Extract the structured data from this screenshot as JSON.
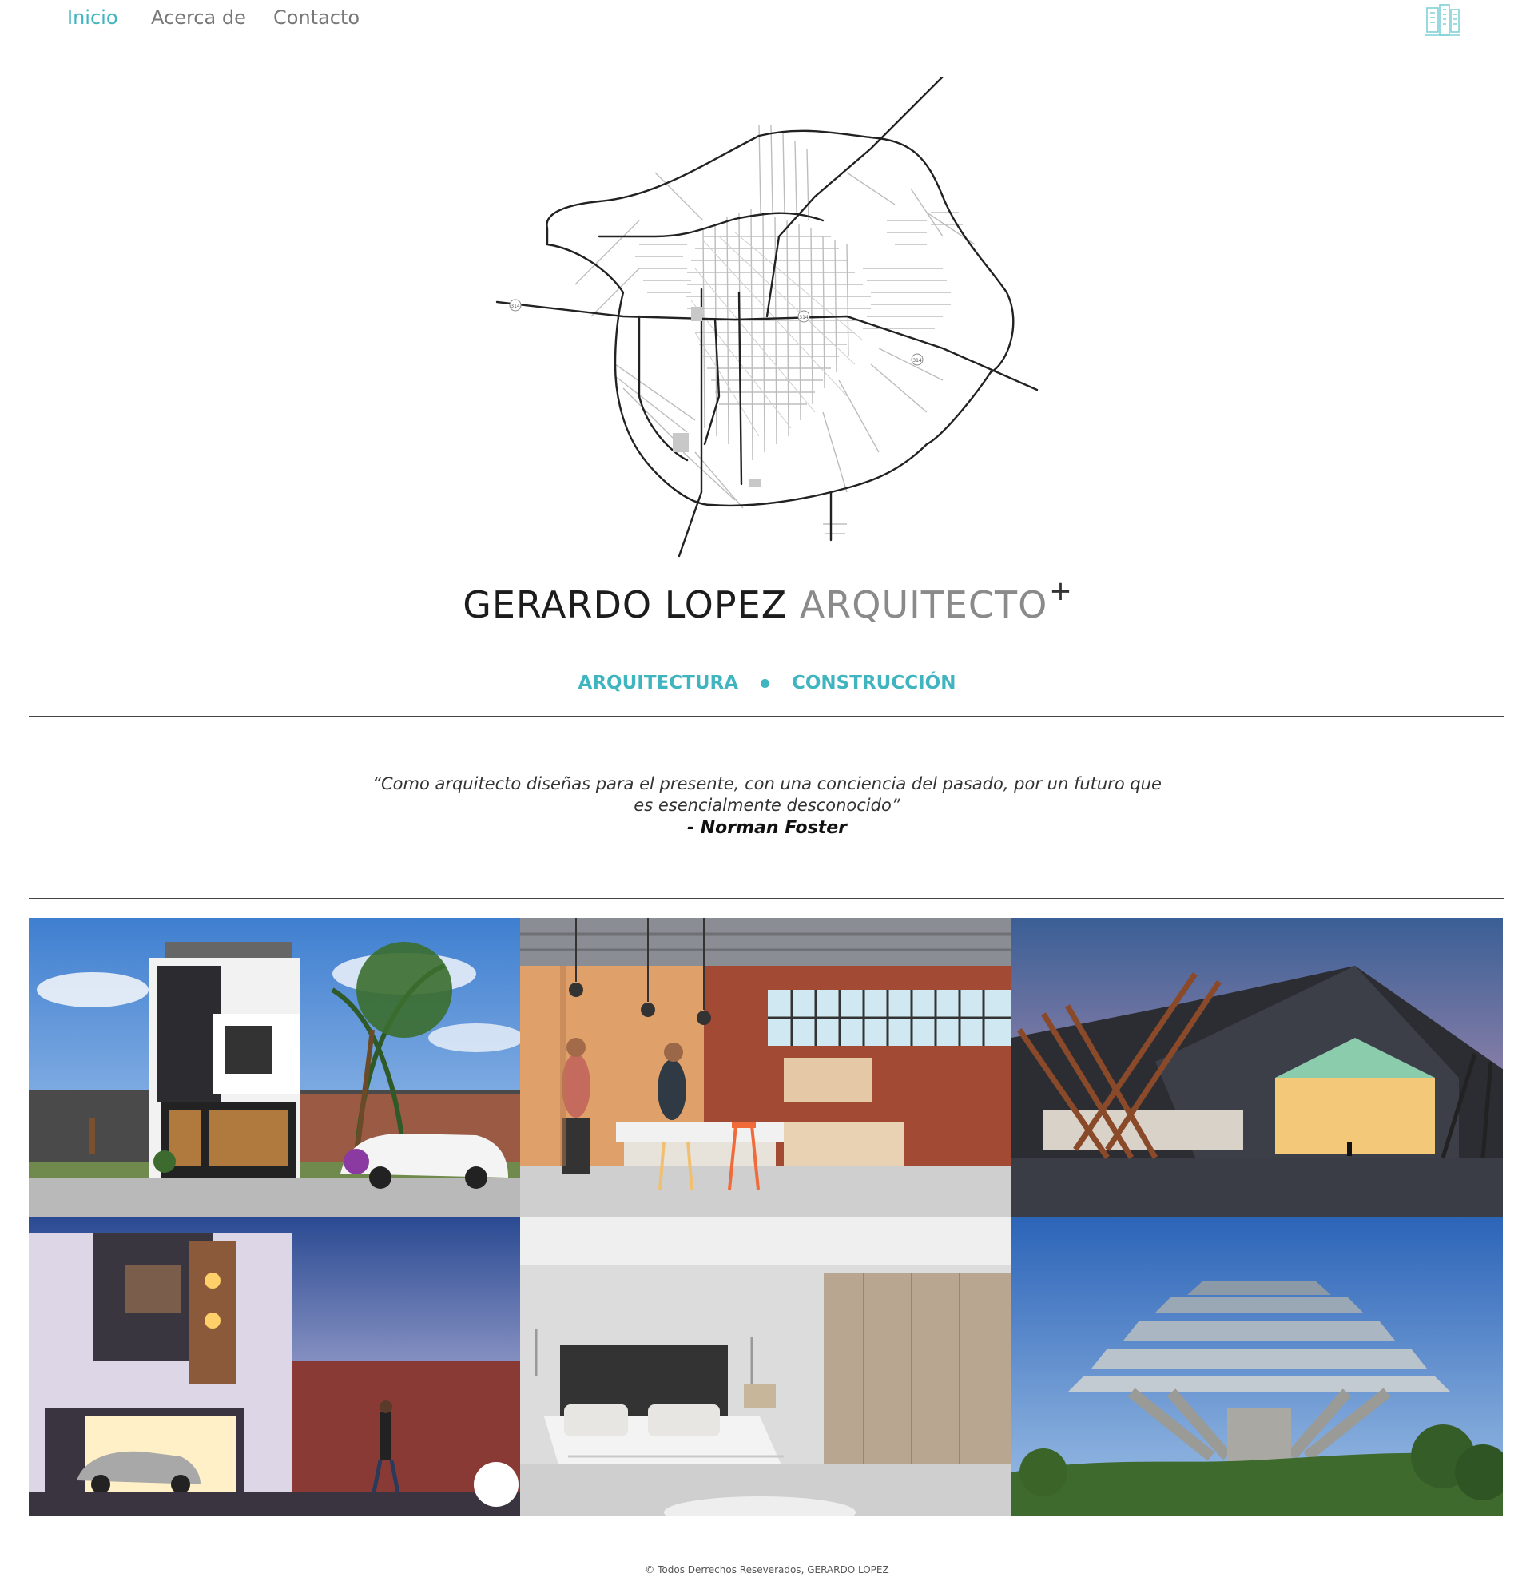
{
  "nav": {
    "items": [
      {
        "label": "Inicio",
        "active": true
      },
      {
        "label": "Acerca de",
        "active": false
      },
      {
        "label": "Contacto",
        "active": false
      }
    ],
    "logo_icon": "building-logo-icon"
  },
  "hero": {
    "map_icon": "city-map-illustration",
    "road_labels": [
      "314",
      "314",
      "314"
    ],
    "brand_name": "GERARDO LOPEZ",
    "brand_role": "ARQUITECTO",
    "brand_sup": "+",
    "services": [
      "ARQUITECTURA",
      "CONSTRUCCIÓN"
    ]
  },
  "quote": {
    "text": "“Como arquitecto diseñas para el presente, con una conciencia del pasado, por un futuro que es esencialmente desconocido”",
    "author": "- Norman Foster"
  },
  "gallery": [
    {
      "name": "house-render-modern-facade"
    },
    {
      "name": "industrial-kitchen-render"
    },
    {
      "name": "angular-pavilion-render"
    },
    {
      "name": "house-render-night-facade"
    },
    {
      "name": "bedroom-render"
    },
    {
      "name": "library-brutalist-photo"
    }
  ],
  "footer": {
    "text": "© Todos Derrechos Reseverados, GERARDO LOPEZ"
  },
  "colors": {
    "accent": "#40b4bf",
    "text_dark": "#1c1c1c",
    "text_muted": "#8a8a8a"
  }
}
